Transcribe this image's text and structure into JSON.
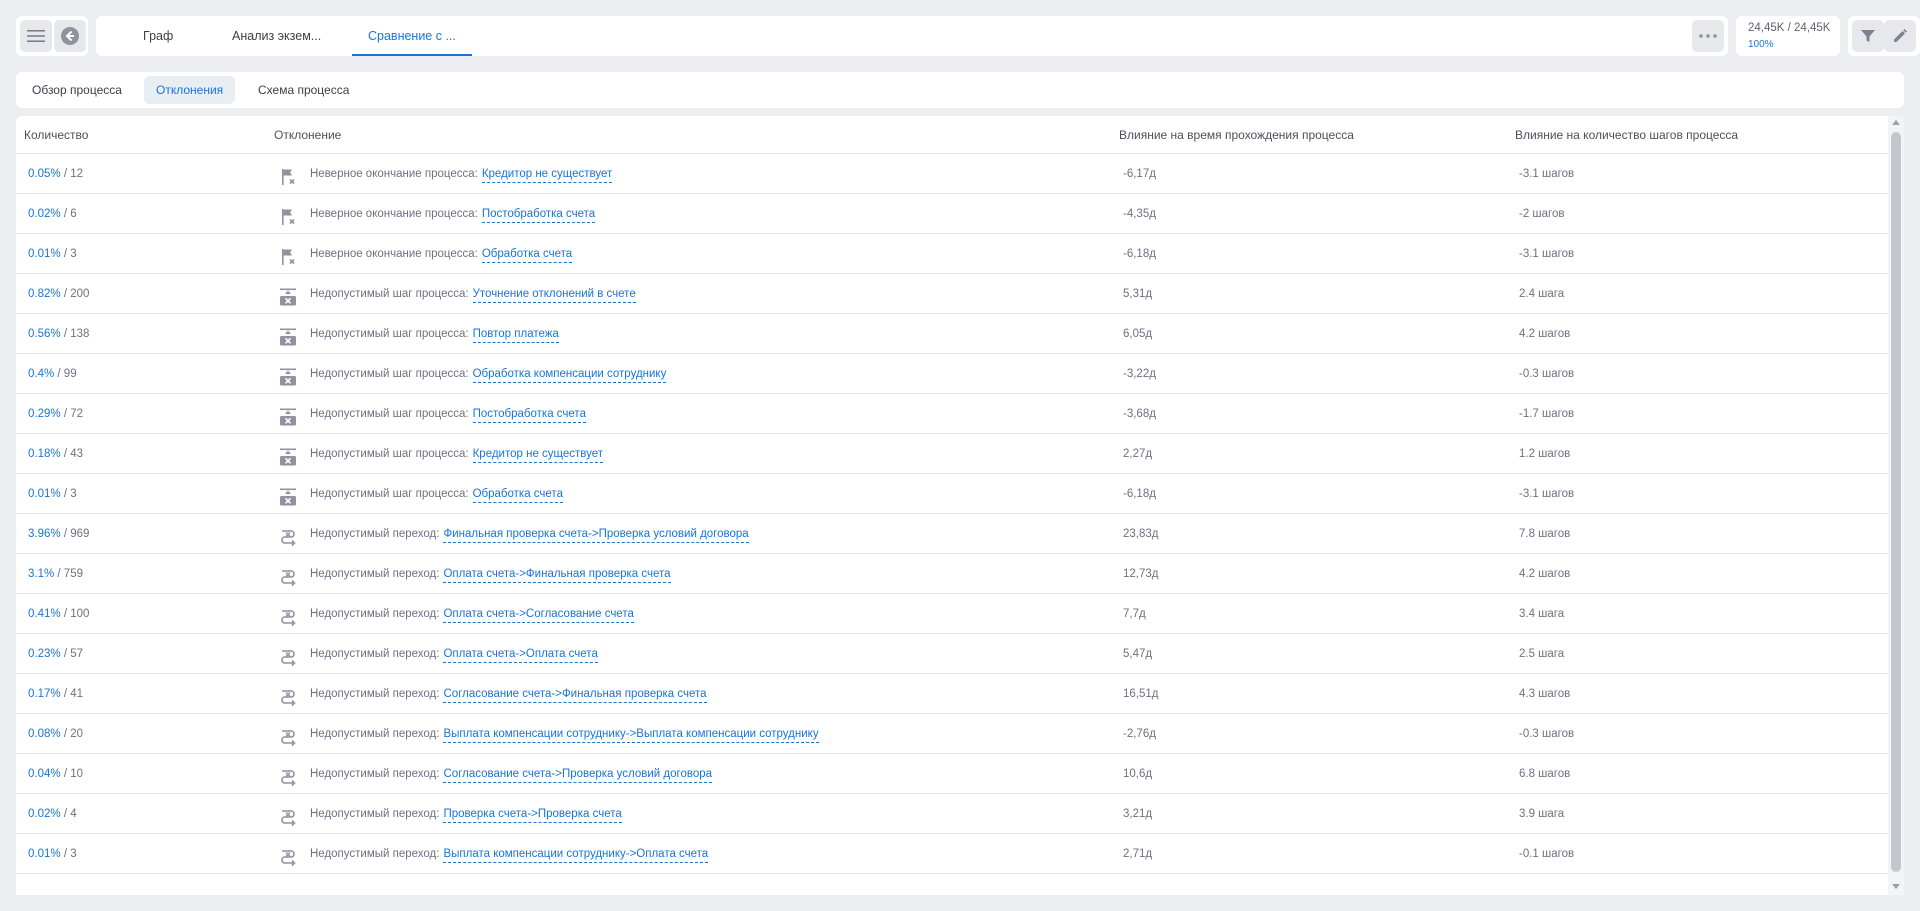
{
  "topbar": {
    "tabs": [
      "Граф",
      "Анализ экзем...",
      "Сравнение с ..."
    ],
    "active_tab": 2,
    "stats_main": "24,45K / 24,45K",
    "stats_sub": "100%"
  },
  "subtabs": [
    "Обзор процесса",
    "Отклонения",
    "Схема процесса"
  ],
  "active_subtab": 1,
  "table": {
    "columns": [
      "Количество",
      "Отклонение",
      "Влияние на время прохождения процесса",
      "Влияние на количество шагов процесса"
    ],
    "rows": [
      {
        "pct": "0.05%",
        "count": "/ 12",
        "icon": "flag-x-icon",
        "type": "Неверное окончание процесса:",
        "link": "Кредитор не существует",
        "time": "-6,17д",
        "steps": "-3.1 шагов"
      },
      {
        "pct": "0.02%",
        "count": "/ 6",
        "icon": "flag-x-icon",
        "type": "Неверное окончание процесса:",
        "link": "Постобработка счета",
        "time": "-4,35д",
        "steps": "-2 шагов"
      },
      {
        "pct": "0.01%",
        "count": "/ 3",
        "icon": "flag-x-icon",
        "type": "Неверное окончание процесса:",
        "link": "Обработка счета",
        "time": "-6,18д",
        "steps": "-3.1 шагов"
      },
      {
        "pct": "0.82%",
        "count": "/ 200",
        "icon": "step-x-icon",
        "type": "Недопустимый шаг процесса:",
        "link": "Уточнение отклонений в счете",
        "time": "5,31д",
        "steps": "2.4 шага"
      },
      {
        "pct": "0.56%",
        "count": "/ 138",
        "icon": "step-x-icon",
        "type": "Недопустимый шаг процесса:",
        "link": "Повтор платежа",
        "time": "6,05д",
        "steps": "4.2 шагов"
      },
      {
        "pct": "0.4%",
        "count": "/ 99",
        "icon": "step-x-icon",
        "type": "Недопустимый шаг процесса:",
        "link": "Обработка компенсации сотруднику",
        "time": "-3,22д",
        "steps": "-0.3 шагов"
      },
      {
        "pct": "0.29%",
        "count": "/ 72",
        "icon": "step-x-icon",
        "type": "Недопустимый шаг процесса:",
        "link": "Постобработка счета",
        "time": "-3,68д",
        "steps": "-1.7 шагов"
      },
      {
        "pct": "0.18%",
        "count": "/ 43",
        "icon": "step-x-icon",
        "type": "Недопустимый шаг процесса:",
        "link": "Кредитор не существует",
        "time": "2,27д",
        "steps": "1.2 шагов"
      },
      {
        "pct": "0.01%",
        "count": "/ 3",
        "icon": "step-x-icon",
        "type": "Недопустимый шаг процесса:",
        "link": "Обработка счета",
        "time": "-6,18д",
        "steps": "-3.1 шагов"
      },
      {
        "pct": "3.96%",
        "count": "/ 969",
        "icon": "transition-x-icon",
        "type": "Недопустимый переход:",
        "link": "Финальная проверка счета->Проверка условий договора",
        "time": "23,83д",
        "steps": "7.8 шагов"
      },
      {
        "pct": "3.1%",
        "count": "/ 759",
        "icon": "transition-x-icon",
        "type": "Недопустимый переход:",
        "link": "Оплата счета->Финальная проверка счета",
        "time": "12,73д",
        "steps": "4.2 шагов"
      },
      {
        "pct": "0.41%",
        "count": "/ 100",
        "icon": "transition-x-icon",
        "type": "Недопустимый переход:",
        "link": "Оплата счета->Согласование счета",
        "time": "7,7д",
        "steps": "3.4 шага"
      },
      {
        "pct": "0.23%",
        "count": "/ 57",
        "icon": "transition-x-icon",
        "type": "Недопустимый переход:",
        "link": "Оплата счета->Оплата счета",
        "time": "5,47д",
        "steps": "2.5 шага"
      },
      {
        "pct": "0.17%",
        "count": "/ 41",
        "icon": "transition-x-icon",
        "type": "Недопустимый переход:",
        "link": "Согласование счета->Финальная проверка счета",
        "time": "16,51д",
        "steps": "4.3 шагов"
      },
      {
        "pct": "0.08%",
        "count": "/ 20",
        "icon": "transition-x-icon",
        "type": "Недопустимый переход:",
        "link": "Выплата компенсации сотруднику->Выплата компенсации сотруднику",
        "time": "-2,76д",
        "steps": "-0.3 шагов"
      },
      {
        "pct": "0.04%",
        "count": "/ 10",
        "icon": "transition-x-icon",
        "type": "Недопустимый переход:",
        "link": "Согласование счета->Проверка условий договора",
        "time": "10,6д",
        "steps": "6.8 шагов"
      },
      {
        "pct": "0.02%",
        "count": "/ 4",
        "icon": "transition-x-icon",
        "type": "Недопустимый переход:",
        "link": "Проверка счета->Проверка счета",
        "time": "3,21д",
        "steps": "3.9 шага"
      },
      {
        "pct": "0.01%",
        "count": "/ 3",
        "icon": "transition-x-icon",
        "type": "Недопустимый переход:",
        "link": "Выплата компенсации сотруднику->Оплата счета",
        "time": "2,71д",
        "steps": "-0.1 шагов"
      }
    ]
  }
}
